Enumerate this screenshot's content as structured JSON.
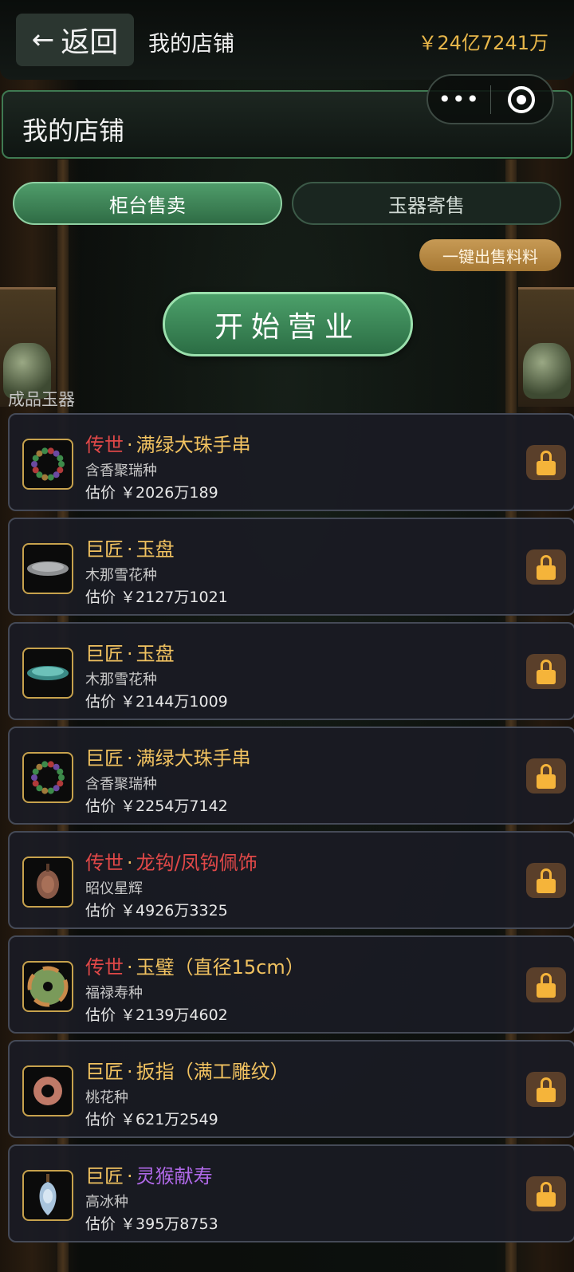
{
  "topbar": {
    "back_label": "返回",
    "title": "我的店铺",
    "money": "￥24亿7241万"
  },
  "capsule": {
    "more_icon": "more-dots-icon",
    "close_icon": "target-icon"
  },
  "shop_header": {
    "title": "我的店铺"
  },
  "tabs": [
    {
      "label": "柜台售卖",
      "active": true
    },
    {
      "label": "玉器寄售",
      "active": false
    }
  ],
  "quick_sell_label": "一键出售料料",
  "open_business_label": "开始营业",
  "section_label": "成品玉器",
  "items": [
    {
      "quality": "传世",
      "name": "满绿大珠手串",
      "name_color": "gold",
      "variety": "含香聚瑞种",
      "price": "估价 ￥2026万189",
      "thumb": "bead-bracelet"
    },
    {
      "quality": "巨匠",
      "name": "玉盘",
      "name_color": "gold",
      "variety": "木那雪花种",
      "price": "估价 ￥2127万1021",
      "thumb": "plate-grey"
    },
    {
      "quality": "巨匠",
      "name": "玉盘",
      "name_color": "gold",
      "variety": "木那雪花种",
      "price": "估价 ￥2144万1009",
      "thumb": "plate-teal"
    },
    {
      "quality": "巨匠",
      "name": "满绿大珠手串",
      "name_color": "gold",
      "variety": "含香聚瑞种",
      "price": "估价 ￥2254万7142",
      "thumb": "bead-bracelet"
    },
    {
      "quality": "传世",
      "name": "龙钩/凤钩佩饰",
      "name_color": "red",
      "variety": "昭仪星辉",
      "price": "估价 ￥4926万3325",
      "thumb": "pendant"
    },
    {
      "quality": "传世",
      "name": "玉璧（直径15cm）",
      "name_color": "gold",
      "variety": "福禄寿种",
      "price": "估价 ￥2139万4602",
      "thumb": "bi-disc"
    },
    {
      "quality": "巨匠",
      "name": "扳指（满工雕纹）",
      "name_color": "gold",
      "variety": "桃花种",
      "price": "估价 ￥621万2549",
      "thumb": "ring"
    },
    {
      "quality": "巨匠",
      "name": "灵猴献寿",
      "name_color": "purple",
      "variety": "高冰种",
      "price": "估价 ￥395万8753",
      "thumb": "monkey-pendant"
    }
  ],
  "colors": {
    "accent_green": "#4f9c6a",
    "gold": "#f1c260",
    "red_quality": "#e04848",
    "purple_name": "#b069e8",
    "money": "#e7b64a"
  }
}
